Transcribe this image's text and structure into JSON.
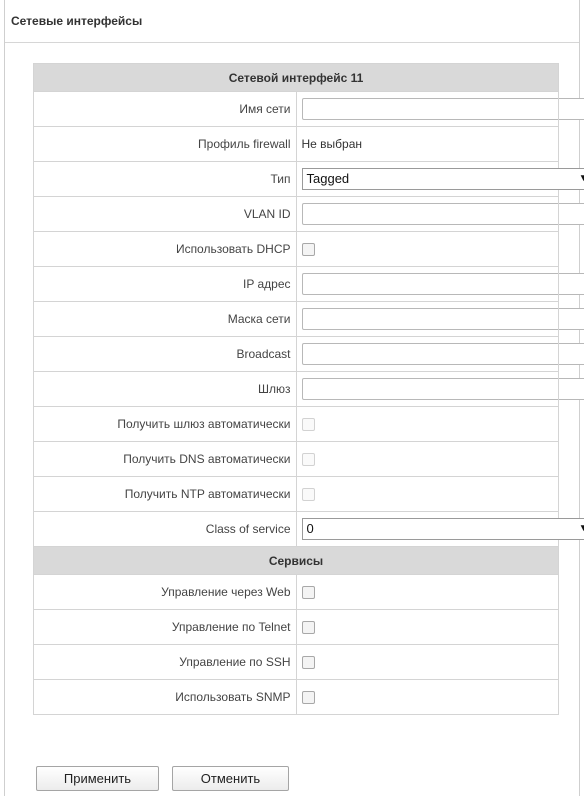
{
  "panel": {
    "title": "Сетевые интерфейсы"
  },
  "form": {
    "section_title": "Сетевой интерфейс 11",
    "network_name": {
      "label": "Имя сети",
      "value": ""
    },
    "firewall_profile": {
      "label": "Профиль firewall",
      "value": "Не выбран"
    },
    "type": {
      "label": "Тип",
      "value": "Tagged"
    },
    "vlan_id": {
      "label": "VLAN ID",
      "value": ""
    },
    "use_dhcp": {
      "label": "Использовать DHCP",
      "checked": false
    },
    "ip_address": {
      "label": "IP адрес",
      "value": ""
    },
    "netmask": {
      "label": "Маска сети",
      "value": ""
    },
    "broadcast": {
      "label": "Broadcast",
      "value": ""
    },
    "gateway": {
      "label": "Шлюз",
      "value": ""
    },
    "auto_gateway": {
      "label": "Получить шлюз автоматически",
      "checked": false,
      "disabled": true
    },
    "auto_dns": {
      "label": "Получить DNS автоматически",
      "checked": false,
      "disabled": true
    },
    "auto_ntp": {
      "label": "Получить NTP автоматически",
      "checked": false,
      "disabled": true
    },
    "class_of_service": {
      "label": "Class of service",
      "value": "0"
    }
  },
  "services": {
    "section_title": "Сервисы",
    "web": {
      "label": "Управление через Web",
      "checked": false
    },
    "telnet": {
      "label": "Управление по Telnet",
      "checked": false
    },
    "ssh": {
      "label": "Управление по SSH",
      "checked": false
    },
    "snmp": {
      "label": "Использовать SNMP",
      "checked": false
    }
  },
  "buttons": {
    "apply": "Применить",
    "cancel": "Отменить"
  }
}
